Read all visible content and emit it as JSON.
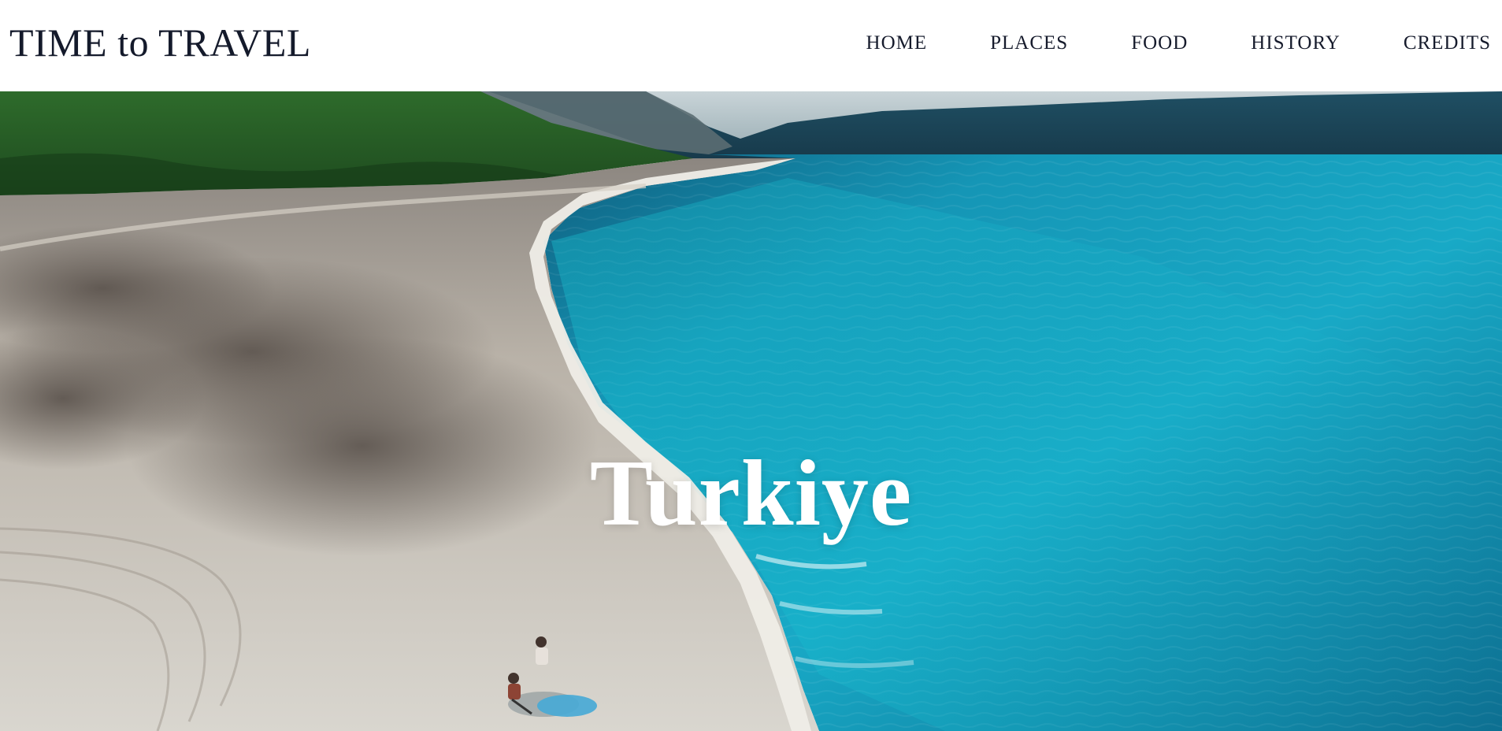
{
  "brand": {
    "title": "TIME to TRAVEL"
  },
  "nav": {
    "items": [
      {
        "label": "HOME"
      },
      {
        "label": "PLACES"
      },
      {
        "label": "FOOD"
      },
      {
        "label": "HISTORY"
      },
      {
        "label": "CREDITS"
      }
    ]
  },
  "hero": {
    "title": "Turkiye",
    "image": "aerial-lake-shoreline-photo"
  },
  "colors": {
    "text_dark": "#141a2b",
    "hero_text": "#ffffff",
    "water": "#1aa7c2",
    "forest": "#2f6f2a"
  }
}
